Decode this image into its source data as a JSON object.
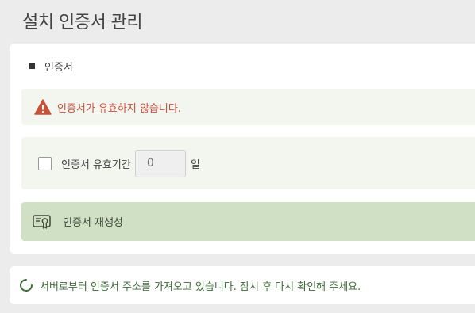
{
  "page": {
    "title": "설치 인증서 관리"
  },
  "certificate_section": {
    "heading": "인증서",
    "alert": {
      "icon": "warning-triangle-icon",
      "message": "인증서가 유효하지 않습니다.",
      "color": "#c9503a"
    },
    "validity": {
      "checkbox_checked": false,
      "label": "인증서 유효기간",
      "days_placeholder": "0",
      "unit": "일"
    },
    "regenerate_button": {
      "icon": "certificate-icon",
      "label": "인증서 재생성",
      "color": "#cfe0c4"
    }
  },
  "status": {
    "icon": "spinner-icon",
    "message": "서버로부터 인증서 주소를 가져오고 있습니다. 잠시 후 다시 확인해 주세요.",
    "color": "#3f6b3a"
  }
}
